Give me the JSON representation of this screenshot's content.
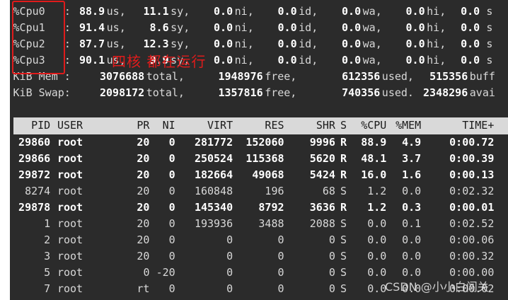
{
  "cpu_rows": [
    {
      "label": "%Cpu0",
      "us": "88.9",
      "sy": "11.1",
      "ni": "0.0",
      "id": "0.0",
      "wa": "0.0",
      "hi": "0.0"
    },
    {
      "label": "%Cpu1",
      "us": "91.4",
      "sy": "8.6",
      "ni": "0.0",
      "id": "0.0",
      "wa": "0.0",
      "hi": "0.0"
    },
    {
      "label": "%Cpu2",
      "us": "87.7",
      "sy": "12.3",
      "ni": "0.0",
      "id": "0.0",
      "wa": "0.0",
      "hi": "0.0"
    },
    {
      "label": "%Cpu3",
      "us": "90.1",
      "sy": "9.9",
      "ni": "0.0",
      "id": "0.0",
      "wa": "0.0",
      "hi": "0.0"
    }
  ],
  "cpu_units": {
    "us": "us,",
    "sy": "sy,",
    "ni": "ni,",
    "id": "id,",
    "wa": "wa,",
    "hi": "hi,",
    "si": "s"
  },
  "mem": {
    "label": "KiB Mem :",
    "total": "3076688",
    "total_lbl": "total,",
    "free": "1948976",
    "free_lbl": "free,",
    "used": "612356",
    "used_lbl": "used,",
    "buff": "515356",
    "buff_lbl": "buff"
  },
  "swap": {
    "label": "KiB Swap:",
    "total": "2098172",
    "total_lbl": "total,",
    "free": "1357816",
    "free_lbl": "free,",
    "used": "740356",
    "used_lbl": "used.",
    "avail": "2348296",
    "avail_lbl": "avai"
  },
  "columns": [
    "PID",
    "USER",
    "PR",
    "NI",
    "VIRT",
    "RES",
    "SHR",
    "S",
    "%CPU",
    "%MEM",
    "TIME+"
  ],
  "processes": [
    {
      "pid": "29860",
      "user": "root",
      "pr": "20",
      "ni": "0",
      "virt": "281772",
      "res": "152060",
      "shr": "9996",
      "s": "R",
      "cpu": "88.9",
      "mem": "4.9",
      "time": "0:00.72",
      "bold": true
    },
    {
      "pid": "29866",
      "user": "root",
      "pr": "20",
      "ni": "0",
      "virt": "250524",
      "res": "115368",
      "shr": "5620",
      "s": "R",
      "cpu": "48.1",
      "mem": "3.7",
      "time": "0:00.39",
      "bold": true
    },
    {
      "pid": "29872",
      "user": "root",
      "pr": "20",
      "ni": "0",
      "virt": "182664",
      "res": "49068",
      "shr": "5424",
      "s": "R",
      "cpu": "16.0",
      "mem": "1.6",
      "time": "0:00.13",
      "bold": true
    },
    {
      "pid": "8274",
      "user": "root",
      "pr": "20",
      "ni": "0",
      "virt": "160848",
      "res": "196",
      "shr": "68",
      "s": "S",
      "cpu": "1.2",
      "mem": "0.0",
      "time": "0:02.32",
      "bold": false
    },
    {
      "pid": "29878",
      "user": "root",
      "pr": "20",
      "ni": "0",
      "virt": "145340",
      "res": "8792",
      "shr": "3636",
      "s": "R",
      "cpu": "1.2",
      "mem": "0.3",
      "time": "0:00.01",
      "bold": true
    },
    {
      "pid": "1",
      "user": "root",
      "pr": "20",
      "ni": "0",
      "virt": "193936",
      "res": "3488",
      "shr": "2088",
      "s": "S",
      "cpu": "0.0",
      "mem": "0.1",
      "time": "0:02.52",
      "bold": false
    },
    {
      "pid": "2",
      "user": "root",
      "pr": "20",
      "ni": "0",
      "virt": "0",
      "res": "0",
      "shr": "0",
      "s": "S",
      "cpu": "0.0",
      "mem": "0.0",
      "time": "0:00.06",
      "bold": false
    },
    {
      "pid": "3",
      "user": "root",
      "pr": "20",
      "ni": "0",
      "virt": "0",
      "res": "0",
      "shr": "0",
      "s": "S",
      "cpu": "0.0",
      "mem": "0.0",
      "time": "0:00.32",
      "bold": false
    },
    {
      "pid": "5",
      "user": "root",
      "pr": "0",
      "ni": "-20",
      "virt": "0",
      "res": "0",
      "shr": "0",
      "s": "S",
      "cpu": "0.0",
      "mem": "0.0",
      "time": "0:00.00",
      "bold": false
    },
    {
      "pid": "7",
      "user": "root",
      "pr": "rt",
      "ni": "0",
      "virt": "0",
      "res": "0",
      "shr": "0",
      "s": "S",
      "cpu": "0.0",
      "mem": "0.0",
      "time": "0:00.02",
      "bold": false
    }
  ],
  "annotation": "四核 都在运行",
  "watermark": "CSDN @小小白闯关"
}
